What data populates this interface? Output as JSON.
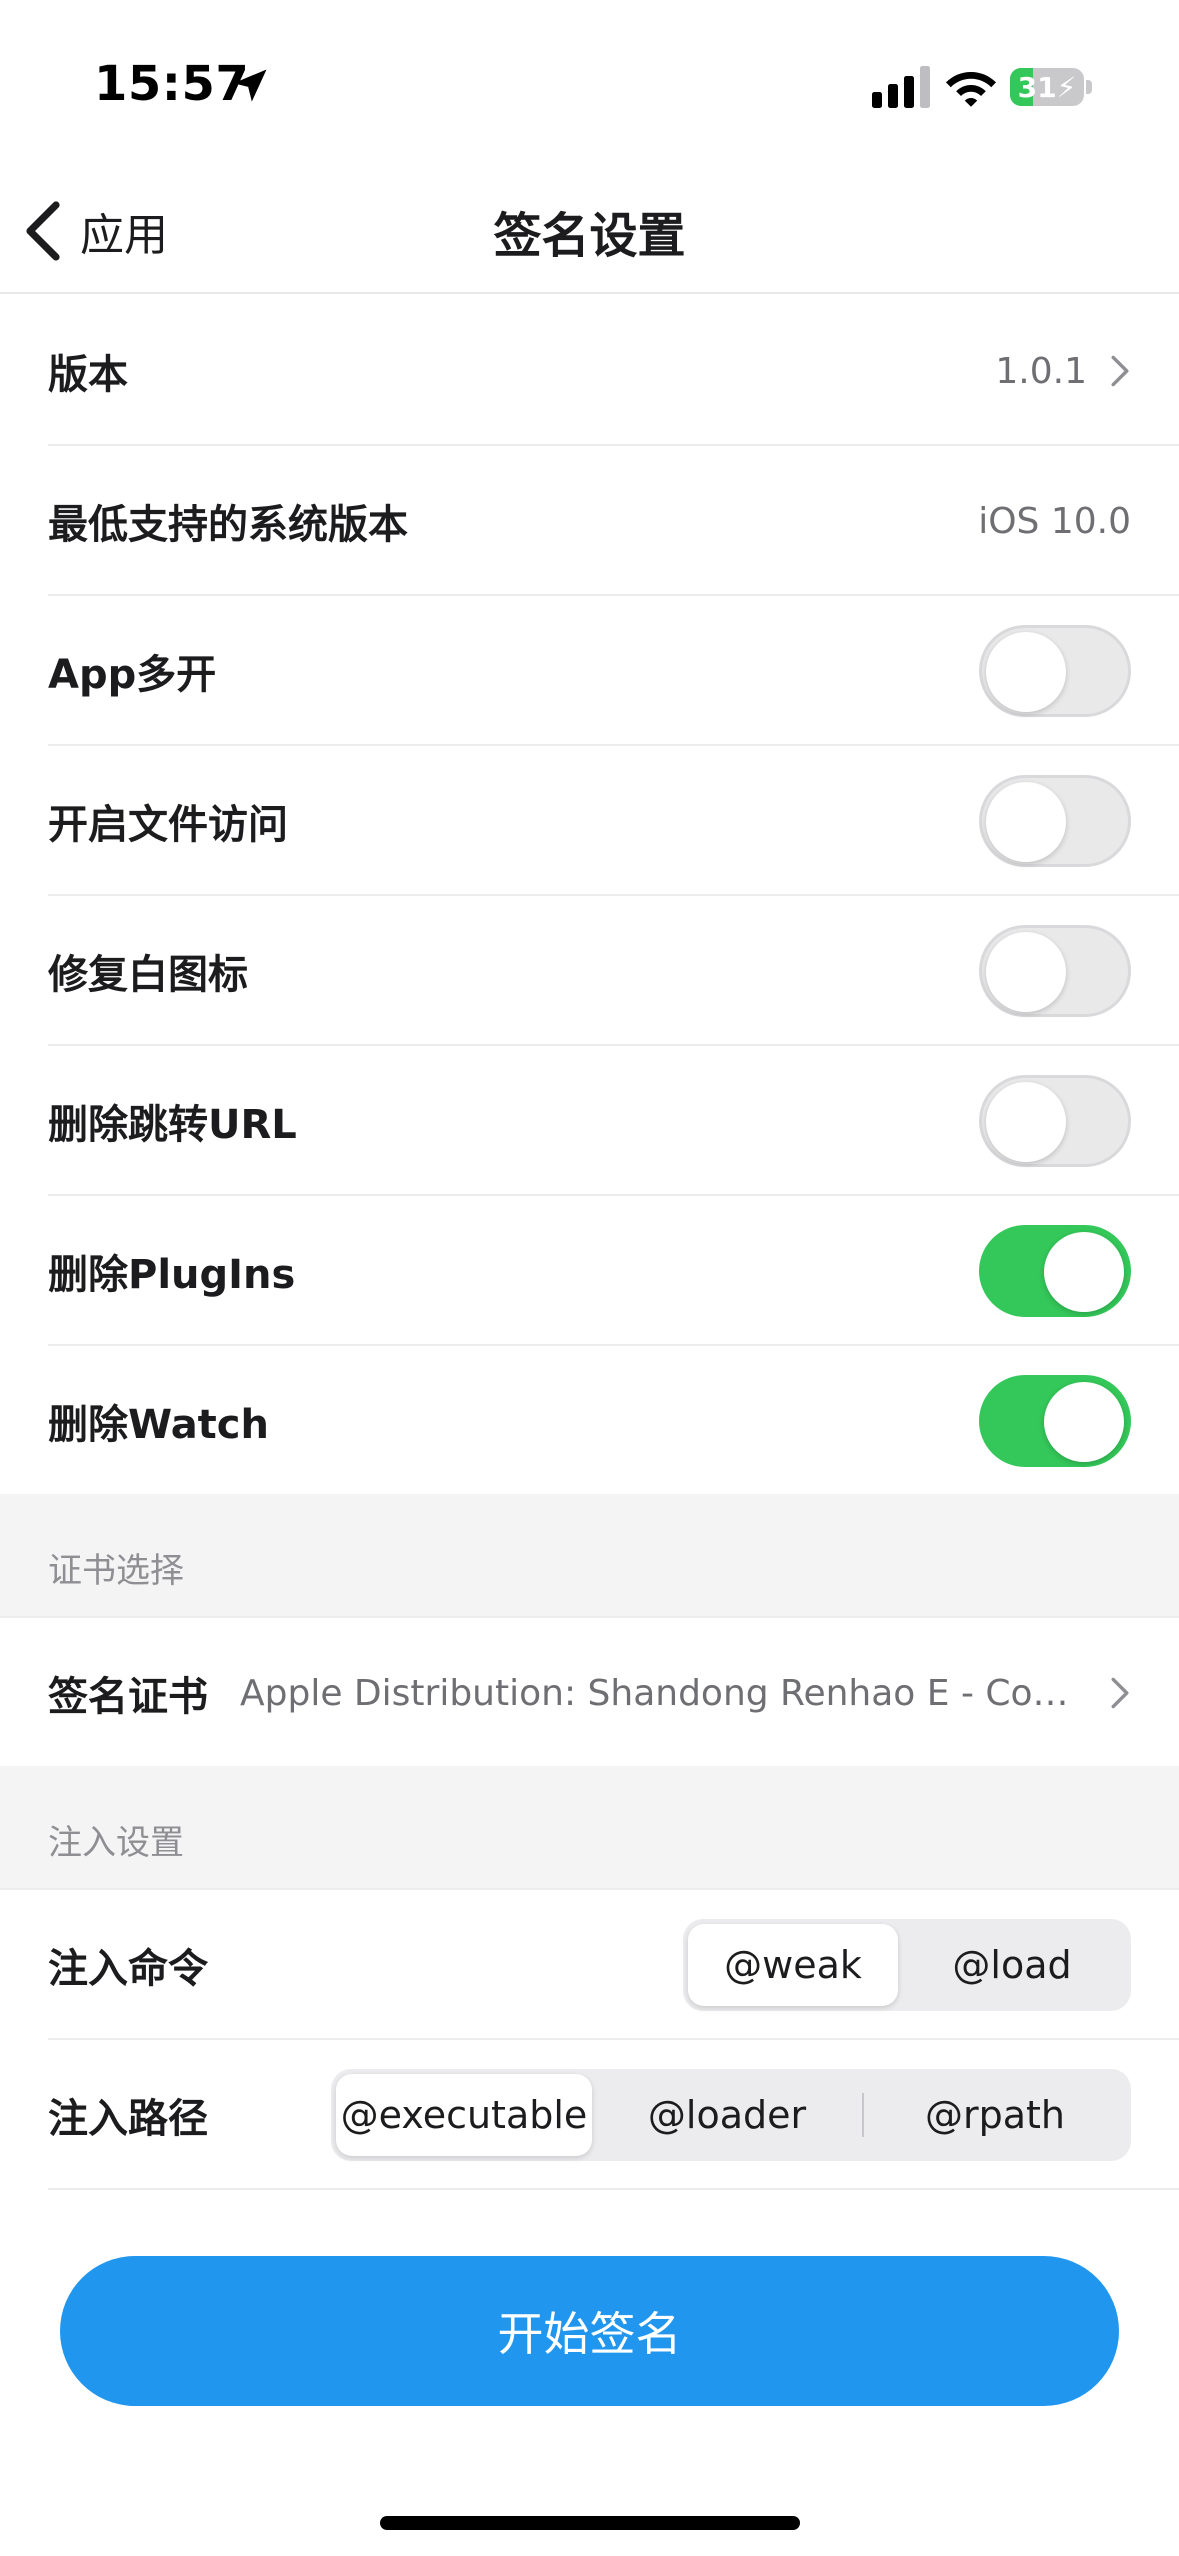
{
  "status_bar": {
    "time": "15:57",
    "battery_level": "31",
    "battery_fraction": 0.31,
    "icons": [
      "location-arrow-icon",
      "cellular-signal-icon",
      "wifi-icon",
      "battery-charging-icon"
    ]
  },
  "nav": {
    "back_label": "应用",
    "title": "签名设置"
  },
  "rows": {
    "version": {
      "label": "版本",
      "value": "1.0.1"
    },
    "min_os": {
      "label": "最低支持的系统版本",
      "value": "iOS 10.0"
    },
    "app_multi": {
      "label": "App多开",
      "on": false
    },
    "file_access": {
      "label": "开启文件访问",
      "on": false
    },
    "fix_white_icon": {
      "label": "修复白图标",
      "on": false
    },
    "remove_url": {
      "label": "删除跳转URL",
      "on": false
    },
    "remove_plugins": {
      "label": "删除PlugIns",
      "on": true
    },
    "remove_watch": {
      "label": "删除Watch",
      "on": true
    }
  },
  "cert_section": {
    "header": "证书选择",
    "label": "签名证书",
    "value": "Apple Distribution: Shandong Renhao E - Comm..."
  },
  "inject_section": {
    "header": "注入设置",
    "command": {
      "label": "注入命令",
      "options": [
        "@weak",
        "@load"
      ],
      "selected": "@weak"
    },
    "path": {
      "label": "注入路径",
      "options": [
        "@executable",
        "@loader",
        "@rpath"
      ],
      "selected": "@executable"
    }
  },
  "primary_button": {
    "label": "开始签名"
  },
  "colors": {
    "accent": "#2196ef",
    "toggle_on": "#34c759",
    "section_bg": "#f4f4f5"
  }
}
